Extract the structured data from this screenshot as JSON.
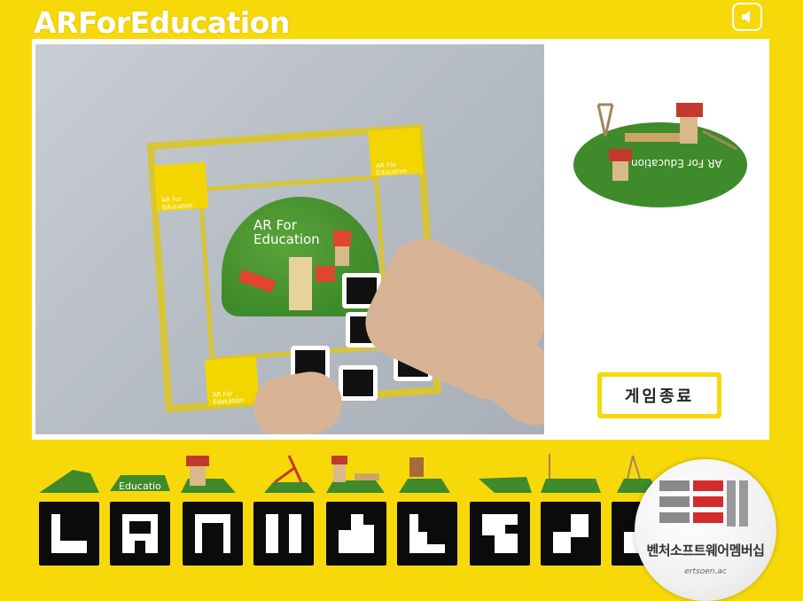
{
  "app": {
    "title": "ARForEducation"
  },
  "camera": {
    "island_label_line1": "AR For",
    "island_label_line2": "Education"
  },
  "preview": {
    "label": "AR For Education"
  },
  "controls": {
    "end_game_label": "게임종료"
  },
  "pieces": [
    {
      "name": "grass-wedge"
    },
    {
      "name": "logo-plate",
      "label": "Educatio"
    },
    {
      "name": "slide-house"
    },
    {
      "name": "swing-slide"
    },
    {
      "name": "bench-tower"
    },
    {
      "name": "red-chair"
    },
    {
      "name": "grass-slab"
    },
    {
      "name": "flag-pole"
    },
    {
      "name": "swing"
    }
  ],
  "watermark": {
    "text": "벤처소프트웨어멤버십",
    "url": "ertsoen.ac"
  },
  "colors": {
    "frame": "#f7d90a",
    "grass": "#3f8a2a",
    "marker": "#0b0b0b",
    "panel": "#ffffff"
  },
  "icons": {
    "sound": "speaker-icon"
  }
}
